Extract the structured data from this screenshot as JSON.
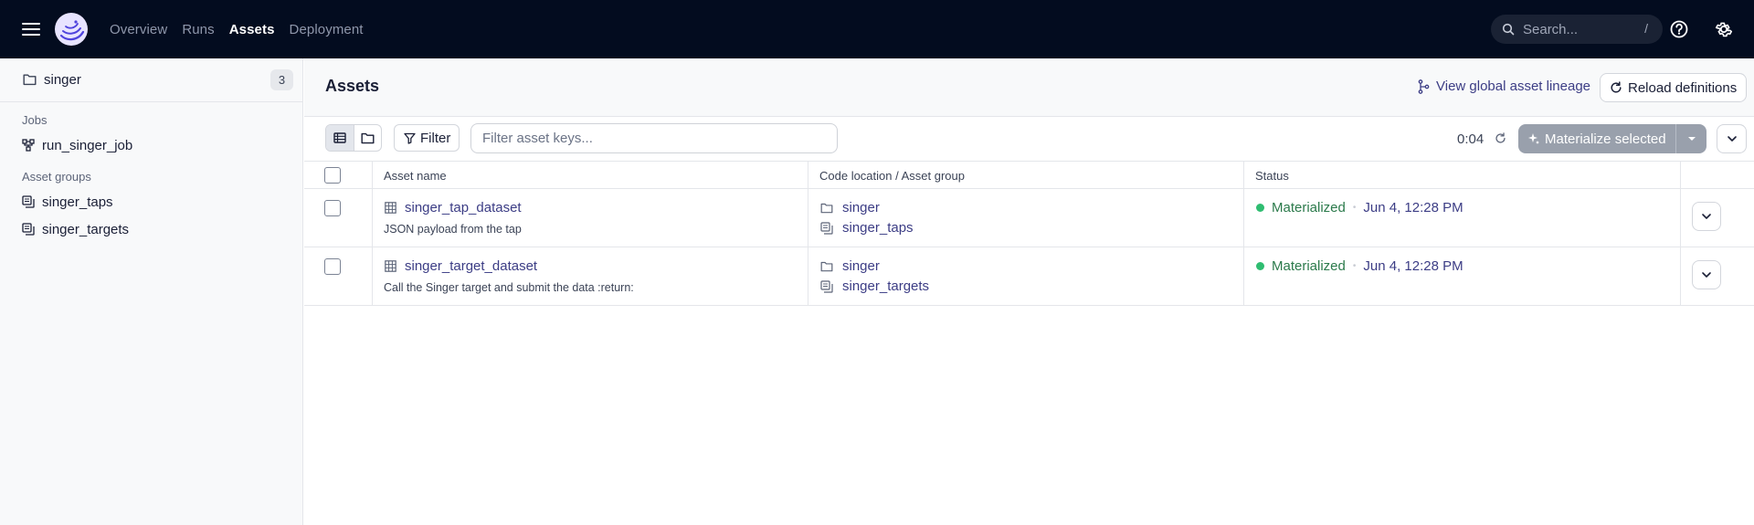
{
  "topbar": {
    "nav": [
      {
        "label": "Overview",
        "active": false
      },
      {
        "label": "Runs",
        "active": false
      },
      {
        "label": "Assets",
        "active": true
      },
      {
        "label": "Deployment",
        "active": false
      }
    ],
    "search": {
      "placeholder": "Search...",
      "shortcut": "/"
    }
  },
  "sidebar": {
    "repo": {
      "name": "singer",
      "count": "3"
    },
    "jobs_label": "Jobs",
    "jobs": [
      {
        "label": "run_singer_job"
      }
    ],
    "asset_groups_label": "Asset groups",
    "asset_groups": [
      {
        "label": "singer_taps"
      },
      {
        "label": "singer_targets"
      }
    ]
  },
  "main": {
    "title": "Assets",
    "lineage_link": "View global asset lineage",
    "reload_label": "Reload definitions",
    "toolbar": {
      "filter_label": "Filter",
      "filter_placeholder": "Filter asset keys...",
      "timer": "0:04",
      "materialize_label": "Materialize selected"
    },
    "table": {
      "headers": [
        "Asset name",
        "Code location / Asset group",
        "Status"
      ],
      "rows": [
        {
          "name": "singer_tap_dataset",
          "description": "JSON payload from the tap",
          "location": "singer",
          "group": "singer_taps",
          "status": "Materialized",
          "time": "Jun 4, 12:28 PM"
        },
        {
          "name": "singer_target_dataset",
          "description": "Call the Singer target and submit the data :return:",
          "location": "singer",
          "group": "singer_targets",
          "status": "Materialized",
          "time": "Jun 4, 12:28 PM"
        }
      ]
    }
  },
  "colors": {
    "topbar_bg": "#030c1f",
    "link": "#3c3d85",
    "success": "#2fbd71",
    "materialize_disabled": "#99a0ac"
  },
  "icons": [
    "menu-icon",
    "dagster-logo-icon",
    "search-icon",
    "help-icon",
    "gear-icon",
    "folder-icon",
    "job-graph-icon",
    "asset-group-icon",
    "lineage-icon",
    "reload-icon",
    "table-view-icon",
    "folder-view-icon",
    "filter-icon",
    "refresh-icon",
    "sparkle-icon",
    "caret-down-icon",
    "chevron-down-icon",
    "table-icon"
  ]
}
